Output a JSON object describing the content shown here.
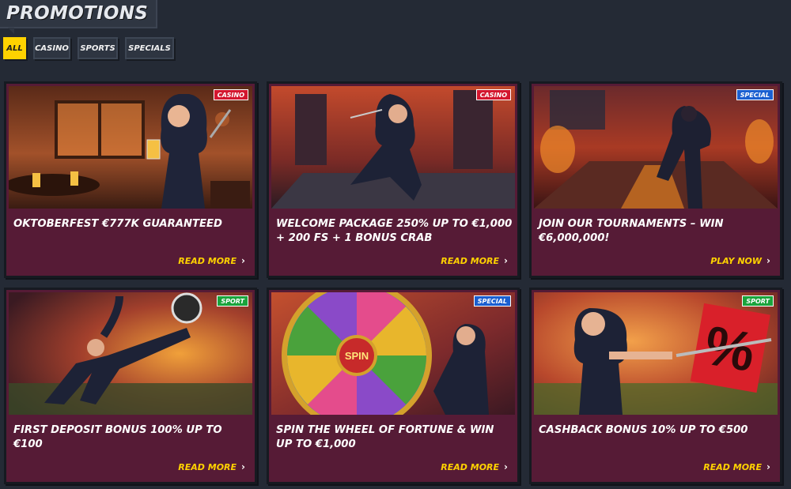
{
  "header": {
    "title": "PROMOTIONS"
  },
  "filters": [
    {
      "label": "ALL",
      "active": true
    },
    {
      "label": "CASINO",
      "active": false
    },
    {
      "label": "SPORTS",
      "active": false
    },
    {
      "label": "SPECIALS",
      "active": false
    }
  ],
  "colors": {
    "background": "#242a35",
    "card": "#561b36",
    "accent_yellow": "#ffd200",
    "badge_casino": "#d3162e",
    "badge_special": "#1a5fd0",
    "badge_sport": "#1aa43c"
  },
  "promotions": [
    {
      "badge": "CASINO",
      "title": "OKTOBERFEST €777K GUARANTEED",
      "cta": "READ MORE"
    },
    {
      "badge": "CASINO",
      "title": "WELCOME PACKAGE 250% UP TO €1,000 + 200 FS + 1 BONUS CRAB",
      "cta": "READ MORE"
    },
    {
      "badge": "SPECIAL",
      "title": "JOIN OUR TOURNAMENTS – WIN €6,000,000!",
      "cta": "PLAY NOW"
    },
    {
      "badge": "SPORT",
      "title": "FIRST DEPOSIT BONUS 100% UP TO €100",
      "cta": "READ MORE"
    },
    {
      "badge": "SPECIAL",
      "title": "SPIN THE WHEEL OF FORTUNE & WIN UP TO €1,000",
      "cta": "READ MORE"
    },
    {
      "badge": "SPORT",
      "title": "CASHBACK BONUS 10% UP TO €500",
      "cta": "READ MORE"
    }
  ],
  "wheel": {
    "center_label": "SPIN"
  },
  "cashback_sign": "%",
  "icons": {
    "cta_arrow": "chevron-right-icon"
  }
}
